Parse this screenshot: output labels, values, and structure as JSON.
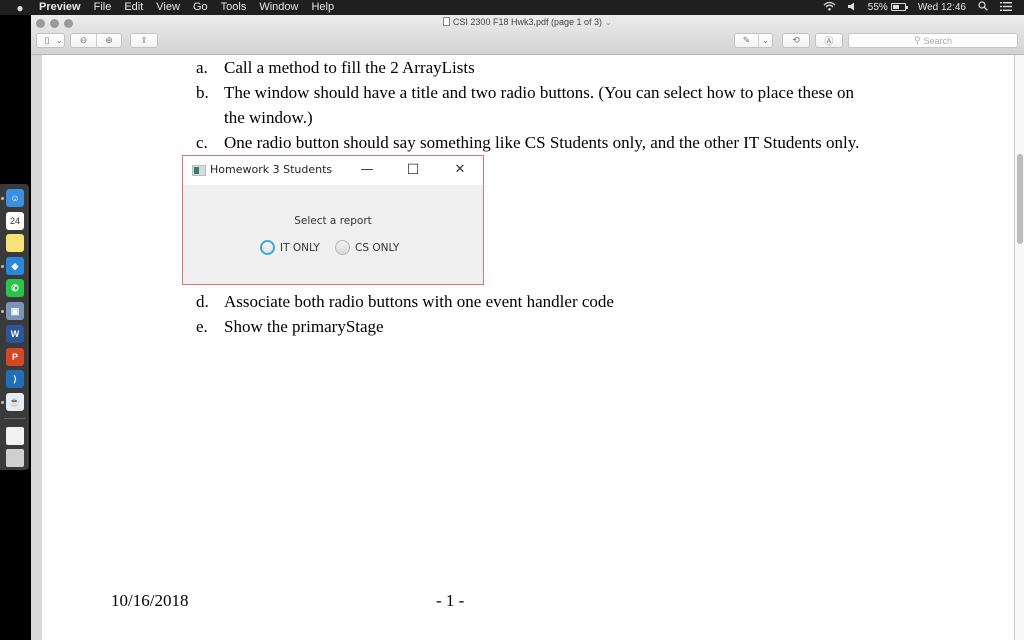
{
  "menubar": {
    "apple_icon": "",
    "app_name": "Preview",
    "items": [
      "File",
      "Edit",
      "View",
      "Go",
      "Tools",
      "Window",
      "Help"
    ],
    "status": {
      "wifi_icon": "wifi-icon",
      "volume_icon": "volume-icon",
      "battery_percent": "55%",
      "clock": "Wed 12:46",
      "spotlight_icon": "search-icon",
      "notification_icon": "list-icon"
    }
  },
  "dock": {
    "apps": [
      {
        "name": "Finder",
        "label": "☺",
        "color": "#3b8fe0",
        "running": true
      },
      {
        "name": "Calendar",
        "label": "24",
        "color": "#ffffff",
        "running": false
      },
      {
        "name": "Notes",
        "label": "",
        "color": "#f7e27a",
        "running": false
      },
      {
        "name": "Safari",
        "label": "◈",
        "color": "#2a86d8",
        "running": true
      },
      {
        "name": "WhatsApp",
        "label": "✆",
        "color": "#2cc34a",
        "running": false
      },
      {
        "name": "Preview",
        "label": "▣",
        "color": "#7a95b8",
        "running": true
      },
      {
        "name": "Word",
        "label": "W",
        "color": "#2b579a",
        "running": false
      },
      {
        "name": "PowerPoint",
        "label": "P",
        "color": "#d24726",
        "running": false
      },
      {
        "name": "Visual Studio Code",
        "label": "⟩",
        "color": "#1e6fb8",
        "running": false
      },
      {
        "name": "Java",
        "label": "☕",
        "color": "#e6eef5",
        "running": true
      },
      {
        "name": "Document",
        "label": "",
        "color": "#f2f2f2",
        "running": false
      },
      {
        "name": "Trash",
        "label": "",
        "color": "#cfcfcf",
        "running": false
      }
    ]
  },
  "window": {
    "title": "CSI 2300 F18 Hwk3.pdf (page 1 of 3)",
    "title_chevron": "⌄",
    "toolbar": {
      "sidebar_icon": "▯",
      "sidebar_chevron": "⌄",
      "zoom_out_icon": "⊖",
      "zoom_in_icon": "⊕",
      "share_icon": "⇪",
      "markup_icon": "✎",
      "markup_chevron": "⌄",
      "rotate_icon": "⟲",
      "annotate_icon": "Ⓐ",
      "search_placeholder": "Search",
      "search_icon": "⚲"
    }
  },
  "document": {
    "items": [
      {
        "label": "a.",
        "text": "Call a method to fill the 2 ArrayLists"
      },
      {
        "label": "b.",
        "text": "The window should have a title and two radio buttons. (You can select how to place these on"
      },
      {
        "label": "",
        "text": "the window.)"
      },
      {
        "label": "c.",
        "text": "One radio button should say something like CS Students only, and the other IT Students only."
      },
      {
        "label": "d.",
        "text": "Associate both radio buttons with one event handler code"
      },
      {
        "label": "e.",
        "text": "Show the primaryStage"
      }
    ],
    "footer_date": "10/16/2018",
    "footer_page": "- 1 -"
  },
  "embedded_window": {
    "title": "Homework 3 Students",
    "minimize": "—",
    "maximize": "☐",
    "close": "✕",
    "prompt": "Select a report",
    "radios": [
      {
        "label": "IT ONLY",
        "focused": true,
        "selected": false
      },
      {
        "label": "CS ONLY",
        "focused": false,
        "selected": false
      }
    ]
  }
}
